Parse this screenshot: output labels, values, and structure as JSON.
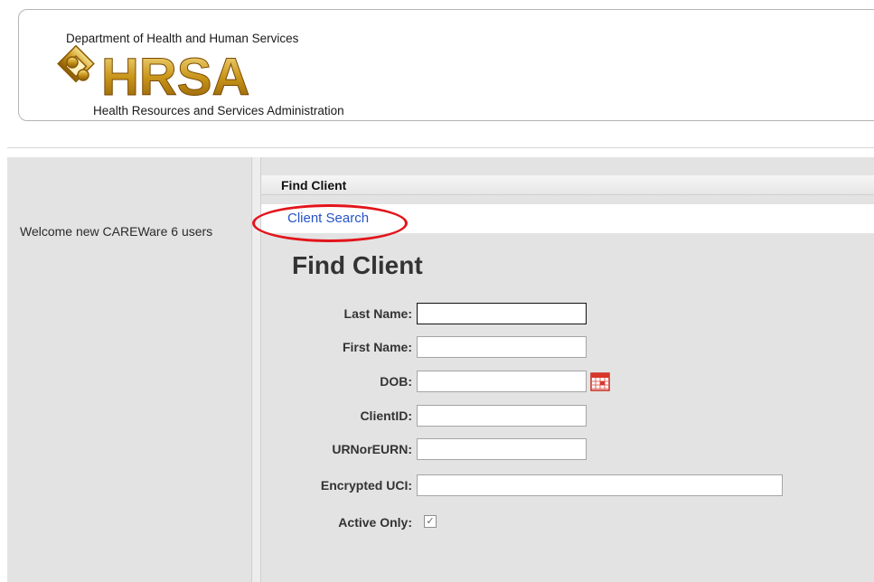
{
  "header": {
    "department": "Department of Health and Human Services",
    "logo_text": "HRSA",
    "subtitle": "Health Resources and Services Administration"
  },
  "sidebar": {
    "welcome_text": "Welcome new CAREWare 6 users"
  },
  "main": {
    "title_bar": "Find Client",
    "breadcrumb": "Client Search",
    "heading": "Find Client",
    "fields": [
      {
        "label": "Last Name:",
        "value": ""
      },
      {
        "label": "First Name:",
        "value": ""
      },
      {
        "label": "DOB:",
        "value": ""
      },
      {
        "label": "ClientID:",
        "value": ""
      },
      {
        "label": "URNorEURN:",
        "value": ""
      },
      {
        "label": "Encrypted UCI:",
        "value": ""
      },
      {
        "label": "Active Only:",
        "checked": true
      }
    ]
  },
  "icons": {
    "calendar": "calendar-icon",
    "logo_emblem": "hrsa-emblem-icon"
  },
  "colors": {
    "link": "#2554c7",
    "highlight": "#e3141b",
    "logo_gold": "#d4a017"
  }
}
